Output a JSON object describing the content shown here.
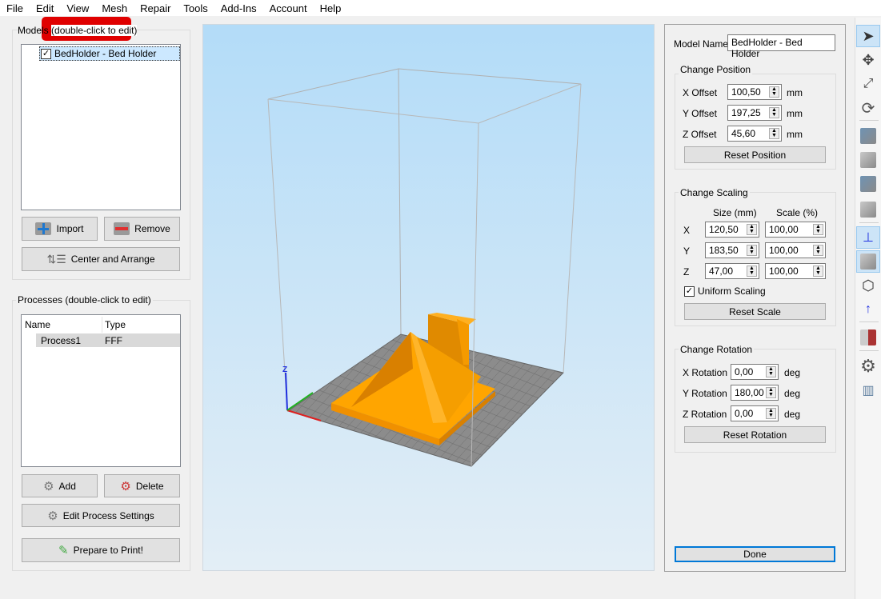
{
  "menu": [
    "File",
    "Edit",
    "View",
    "Mesh",
    "Repair",
    "Tools",
    "Add-Ins",
    "Account",
    "Help"
  ],
  "models": {
    "title_prefix": "Models",
    "title_hint": "(double-click to edit)",
    "items": [
      {
        "label": "BedHolder - Bed Holder",
        "checked": true
      }
    ],
    "import": "Import",
    "remove": "Remove",
    "center": "Center and Arrange"
  },
  "processes": {
    "title": "Processes (double-click to edit)",
    "columns": [
      "Name",
      "Type"
    ],
    "rows": [
      {
        "name": "Process1",
        "type": "FFF"
      }
    ],
    "add": "Add",
    "delete": "Delete",
    "edit": "Edit Process Settings",
    "prepare": "Prepare to Print!"
  },
  "axes": {
    "z": "Z"
  },
  "right": {
    "model_name_label": "Model Name:",
    "model_name": "BedHolder - Bed Holder",
    "position": {
      "title": "Change Position",
      "rows": [
        {
          "label": "X Offset",
          "value": "100,50",
          "unit": "mm"
        },
        {
          "label": "Y Offset",
          "value": "197,25",
          "unit": "mm"
        },
        {
          "label": "Z Offset",
          "value": "45,60",
          "unit": "mm"
        }
      ],
      "reset": "Reset Position"
    },
    "scaling": {
      "title": "Change Scaling",
      "size_header": "Size (mm)",
      "scale_header": "Scale (%)",
      "rows": [
        {
          "axis": "X",
          "size": "120,50",
          "scale": "100,00"
        },
        {
          "axis": "Y",
          "size": "183,50",
          "scale": "100,00"
        },
        {
          "axis": "Z",
          "size": "47,00",
          "scale": "100,00"
        }
      ],
      "uniform": "Uniform Scaling",
      "uniform_checked": true,
      "reset": "Reset Scale"
    },
    "rotation": {
      "title": "Change Rotation",
      "rows": [
        {
          "label": "X Rotation",
          "value": "0,00",
          "unit": "deg"
        },
        {
          "label": "Y Rotation",
          "value": "180,00",
          "unit": "deg"
        },
        {
          "label": "Z Rotation",
          "value": "0,00",
          "unit": "deg"
        }
      ],
      "reset": "Reset Rotation"
    },
    "done": "Done"
  },
  "colors": {
    "model": "#ffa500",
    "highlight": "#e00000",
    "selection": "#cce8ff",
    "accent": "#0078d7"
  },
  "toolbar": [
    "select-icon",
    "move-icon",
    "scale-icon",
    "rotate-icon",
    "view-top-icon",
    "view-front-icon",
    "view-side-icon",
    "view-iso-icon",
    "axes-icon",
    "shaded-view-icon",
    "wireframe-view-icon",
    "normals-icon",
    "cross-section-icon",
    "settings-icon",
    "supports-icon"
  ]
}
